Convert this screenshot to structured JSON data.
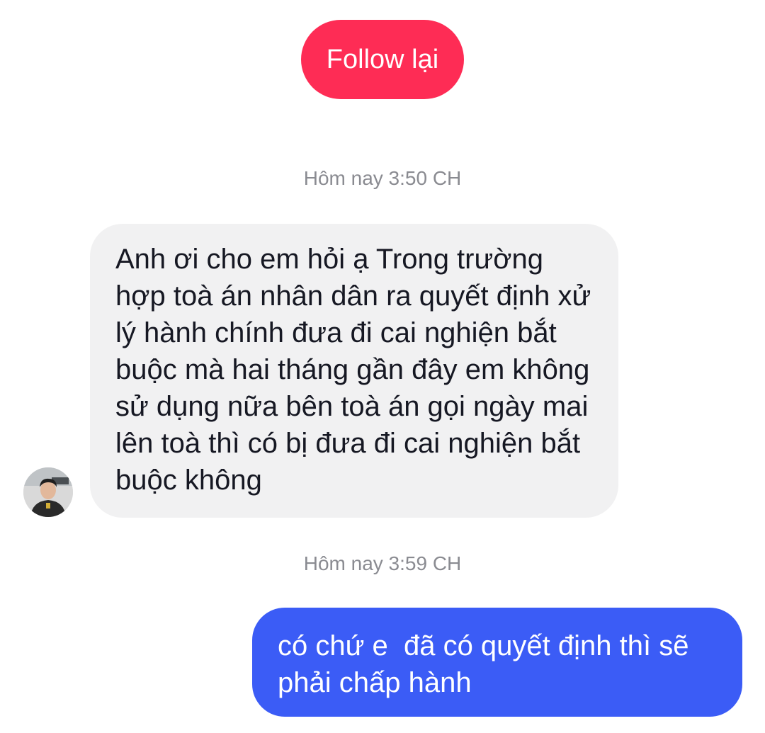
{
  "follow_button": {
    "label": "Follow lại",
    "color": "#fe2c55"
  },
  "conversation": [
    {
      "timestamp": "Hôm nay 3:50 CH",
      "sender": "other",
      "text": "Anh ơi cho em hỏi ạ Trong trường hợp toà án nhân dân ra quyết định xử lý hành chính đưa đi cai nghiện bắt buộc mà hai tháng gần đây em không sử dụng nữa bên toà án gọi ngày mai lên toà thì có bị đưa đi cai nghiện bắt buộc không"
    },
    {
      "timestamp": "Hôm nay 3:59 CH",
      "sender": "me",
      "text": "có chứ e  đã có quyết định thì sẽ phải chấp hành"
    }
  ],
  "colors": {
    "incoming_bubble": "#f1f1f2",
    "outgoing_bubble": "#3b5cf6",
    "timestamp_text": "#8a8b91"
  },
  "icons": {
    "avatar": "user-avatar"
  }
}
